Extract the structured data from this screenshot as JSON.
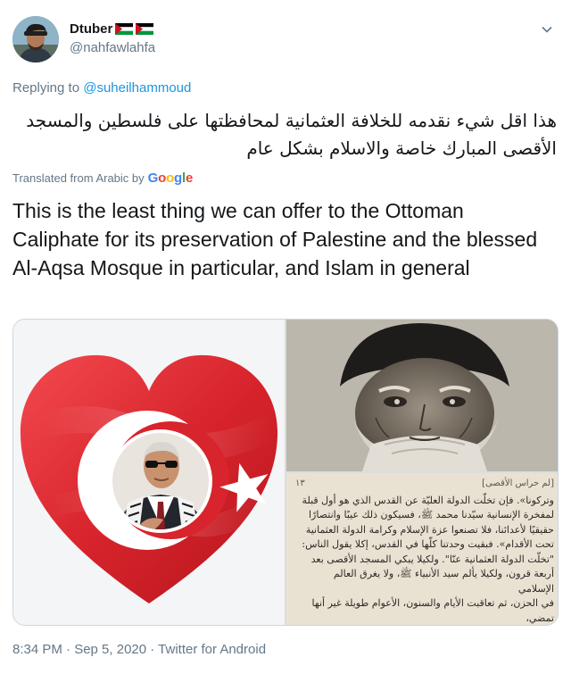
{
  "tweet": {
    "display_name": "Dtuber",
    "handle": "@nahfawlahfa",
    "replying_prefix": "Replying to",
    "replying_to": "@suheilhammoud",
    "original_text": "هذا اقل شيء نقدمه للخلافة العثمانية لمحافظتها على فلسطين والمسجد الأقصى المبارك خاصة والاسلام بشكل عام",
    "translated_from": "Translated from Arabic by",
    "translator": "Google",
    "translation": "This is the least thing we can offer to the Ottoman Caliphate for its preservation of Palestine and the blessed Al-Aqsa Mosque in particular, and Islam in general",
    "timestamp": "8:34 PM · Sep 5, 2020 · Twitter for Android"
  },
  "media": {
    "book_page": {
      "header_left": "[لم حراس الأقصى]",
      "page_number": "١٣",
      "lines": [
        "وتركونا». فإن تخلّت الدولة العليّة عن القدس الذي هو أول قبلة",
        "لمفخرة الإنسانية سيّدنا محمد ﷺ، فسيكون ذلك عيبًا وانتصارًا",
        "حقيقيًا لأعدائنا، فلا تصنعوا عزة الإسلام وكرامة الدولة العثمانية",
        "تحت الأقدام». فبقيت وحدتنا كلّها في القدس، إكلا يقول الناس:",
        "\"تخلّت الدولة العثمانية عنّا\". ولكيلا يبكي المسجد الأقصى بعد",
        "أربعة قرون، ولكيلا يألم سيد الأنبياء ﷺ، ولا يغرق العالم الإسلامي",
        "في الحزن، ثم تعاقبت الأيام والسنون، الأعوام طويلة غير أنها تمضي،"
      ]
    }
  },
  "colors": {
    "secondary_text": "#657786",
    "link": "#1b95e0",
    "turkish_red": "#d8242c"
  },
  "icons": {
    "caret": "chevron-down-icon",
    "flags": "palestine-flag-icon"
  }
}
